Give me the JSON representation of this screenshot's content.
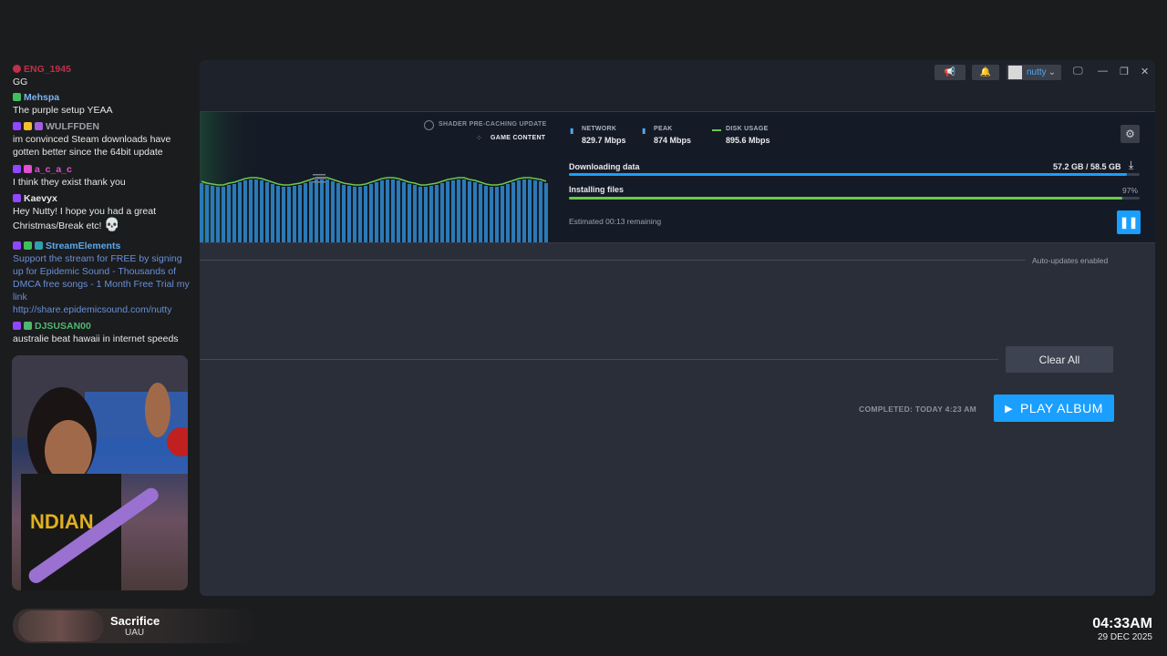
{
  "chat": {
    "messages": [
      {
        "user": "ENG_1945",
        "text": "GG",
        "color": "#c0304a"
      },
      {
        "user": "Mehspa",
        "text": "The purple setup YEAA",
        "color": "#7ab4f0"
      },
      {
        "user": "WULFFDEN",
        "text": "im convinced Steam downloads have gotten better since the 64bit update",
        "color": "#9aa0a8"
      },
      {
        "user": "a_c_a_c",
        "text": "I think they exist thank you",
        "color": "#e050d0"
      },
      {
        "user": "Kaevyx",
        "text": "Hey Nutty! I hope you had a great Christmas/Break etc!",
        "color": "#e8e8e8"
      },
      {
        "user": "StreamElements",
        "text": "Support the stream for FREE by signing up for Epidemic Sound - Thousands of DMCA free songs - 1 Month Free Trial my link",
        "link": "http://share.epidemicsound.com/nutty",
        "color": "#5aa8f0"
      },
      {
        "user": "DJSUSAN00",
        "text": "australie beat hawaii in internet speeds",
        "color": "#4fb870"
      }
    ]
  },
  "steam": {
    "titlebar": {
      "username": "nutty",
      "dropdown_glyph": "⌄"
    },
    "download": {
      "shader_label": "SHADER PRE-CACHING UPDATE",
      "content_label": "GAME CONTENT",
      "network_label": "NETWORK",
      "network_value": "829.7 Mbps",
      "peak_label": "PEAK",
      "peak_value": "874 Mbps",
      "disk_label": "DISK USAGE",
      "disk_value": "895.6 Mbps",
      "downloading_label": "Downloading data",
      "downloading_amount": "57.2 GB / 58.5 GB",
      "downloading_progress": 0.978,
      "installing_label": "Installing files",
      "installing_percent": "97%",
      "installing_progress": 0.97,
      "estimated": "Estimated 00:13 remaining"
    },
    "auto_updates": "Auto-updates enabled",
    "clear_all": "Clear All",
    "completed": "COMPLETED: TODAY 4:23 AM",
    "play_button": "PLAY ALBUM",
    "colors": {
      "accent": "#1a9fff",
      "graph_bar": "#2a7ab8",
      "disk_line": "#6bc94a"
    }
  },
  "now_playing": {
    "title": "Sacrifice",
    "artist": "UAU"
  },
  "clock": {
    "time": "04:33AM",
    "date": "29 DEC 2025"
  }
}
